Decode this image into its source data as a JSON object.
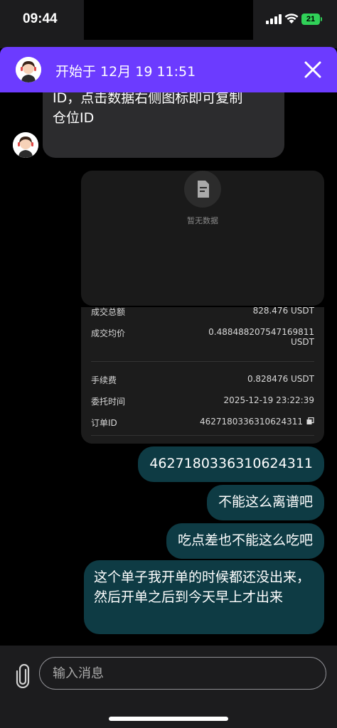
{
  "status": {
    "time": "09:44",
    "battery": "21"
  },
  "header": {
    "title": "开始于 12月 19 11:51"
  },
  "bot_message": {
    "line_partial": "…",
    "line2": "ID，点击数据右侧图标即可复制",
    "line3": "仓位ID"
  },
  "empty_card": {
    "text": "暂无数据"
  },
  "order_card": {
    "rows": [
      {
        "label": "成交总额",
        "value": "828.476 USDT"
      },
      {
        "label": "成交均价",
        "value": "0.488488207547169811",
        "value2": "USDT"
      },
      {
        "label": "手续费",
        "value": "0.828476 USDT"
      },
      {
        "label": "委托时间",
        "value": "2025-12-19 23:22:39"
      },
      {
        "label": "订单ID",
        "value": "4627180336310624311"
      }
    ]
  },
  "user_messages": [
    "4627180336310624311",
    "不能这么离谱吧",
    "吃点差也不能这么吃吧",
    "这个单子我开单的时候都还没出来，然后开单之后到今天早上才出来"
  ],
  "input": {
    "placeholder": "输入消息"
  },
  "colors": {
    "header": "#6c3bff",
    "user_bubble": "#0e3b44",
    "bot_bubble": "#2c2c2e"
  }
}
